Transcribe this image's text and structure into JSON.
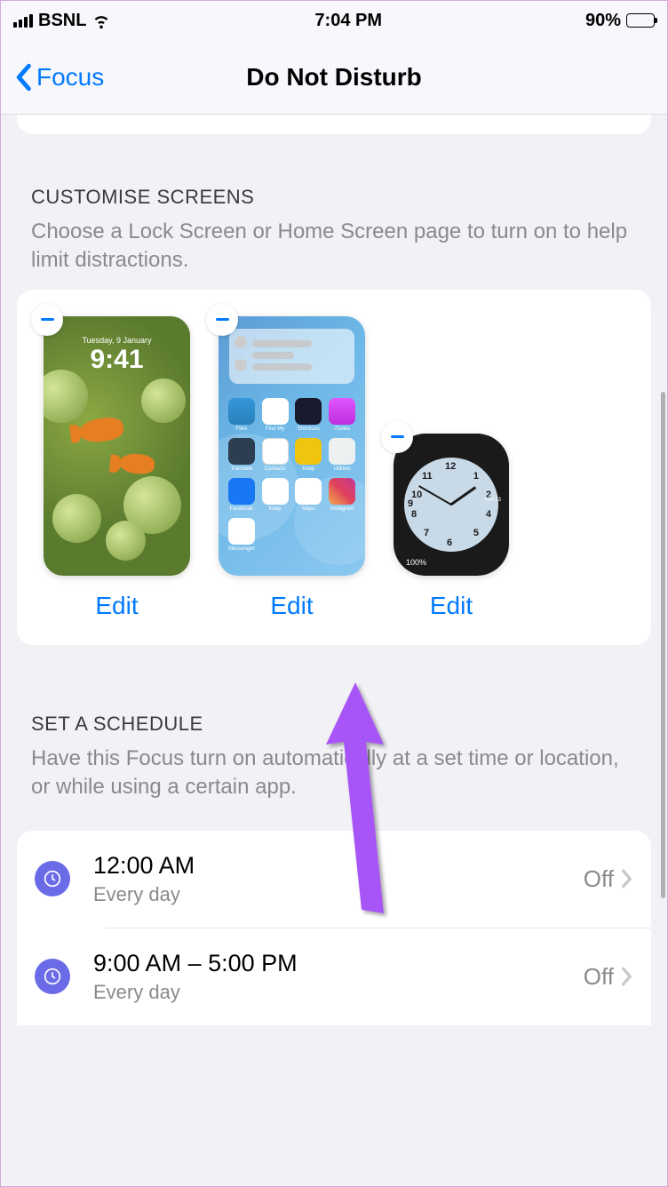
{
  "status": {
    "carrier": "BSNL",
    "time": "7:04 PM",
    "battery": "90%"
  },
  "nav": {
    "back": "Focus",
    "title": "Do Not Disturb"
  },
  "customise": {
    "title": "CUSTOMISE SCREENS",
    "desc": "Choose a Lock Screen or Home Screen page to turn on to help limit distractions.",
    "lock_screen": {
      "date": "Tuesday, 9 January",
      "time": "9:41",
      "edit": "Edit"
    },
    "home_screen": {
      "edit": "Edit"
    },
    "watch": {
      "edit": "Edit"
    }
  },
  "schedule": {
    "title": "SET A SCHEDULE",
    "desc": "Have this Focus turn on automatically at a set time or location, or while using a certain app.",
    "items": [
      {
        "time": "12:00 AM",
        "sub": "Every day",
        "status": "Off"
      },
      {
        "time": "9:00 AM – 5:00 PM",
        "sub": "Every day",
        "status": "Off"
      }
    ]
  }
}
